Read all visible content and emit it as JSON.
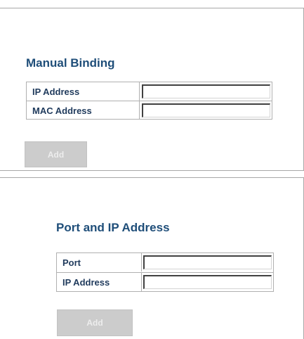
{
  "manual_binding": {
    "title": "Manual Binding",
    "ip_address_label": "IP Address",
    "ip_address_value": "",
    "mac_address_label": "MAC Address",
    "mac_address_value": "",
    "add_label": "Add"
  },
  "port_ip": {
    "title": "Port and IP Address",
    "port_label": "Port",
    "port_value": "",
    "ip_address_label": "IP Address",
    "ip_address_value": "",
    "add_label": "Add"
  },
  "colors": {
    "heading": "#1f4e79",
    "label": "#1f3a5c",
    "button_bg": "#cccccc",
    "button_text": "#ededed",
    "border": "#b0b0b0"
  }
}
